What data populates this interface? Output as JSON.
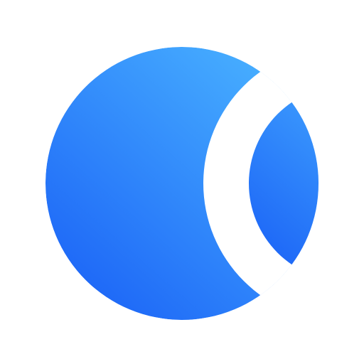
{
  "logo": {
    "icon": "crescent-orb-logo-icon",
    "gradient_start": "#1E68F7",
    "gradient_end": "#47AEFF",
    "background": "#FFFFFF"
  }
}
